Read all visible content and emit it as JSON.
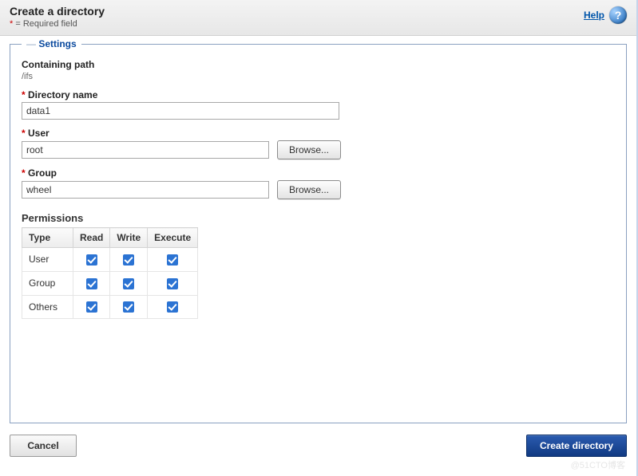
{
  "title": "Create a directory",
  "required_note_star": "*",
  "required_note_text": " = Required field",
  "help": {
    "label": "Help"
  },
  "settings": {
    "legend": "Settings",
    "containing_path": {
      "label": "Containing path",
      "value": "/ifs"
    },
    "directory_name": {
      "label": "Directory name",
      "value": "data1"
    },
    "user": {
      "label": "User",
      "value": "root",
      "browse": "Browse..."
    },
    "group": {
      "label": "Group",
      "value": "wheel",
      "browse": "Browse..."
    },
    "permissions": {
      "title": "Permissions",
      "headers": {
        "type": "Type",
        "read": "Read",
        "write": "Write",
        "execute": "Execute"
      },
      "rows": [
        {
          "type": "User",
          "read": true,
          "write": true,
          "execute": true
        },
        {
          "type": "Group",
          "read": true,
          "write": true,
          "execute": true
        },
        {
          "type": "Others",
          "read": true,
          "write": true,
          "execute": true
        }
      ]
    }
  },
  "footer": {
    "cancel": "Cancel",
    "submit": "Create directory"
  },
  "watermark": "@51CTO博客"
}
